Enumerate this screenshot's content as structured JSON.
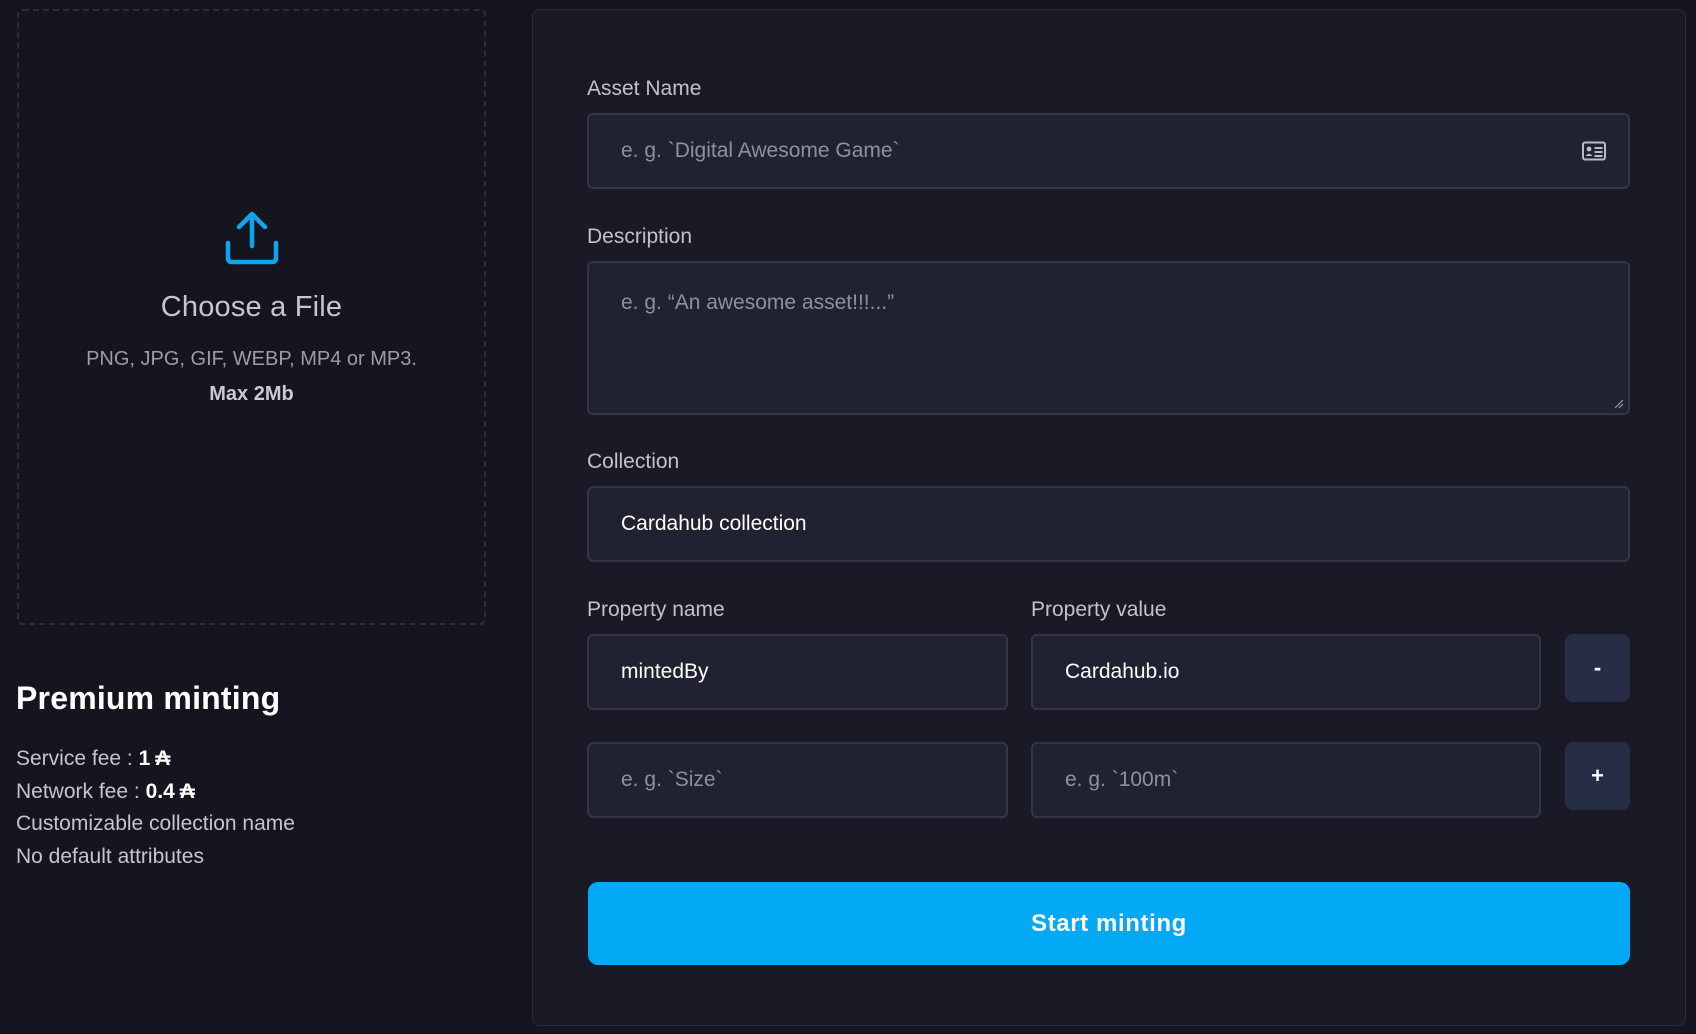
{
  "upload": {
    "title": "Choose a File",
    "types": "PNG, JPG, GIF, WEBP, MP4 or MP3.",
    "max": "Max 2Mb",
    "icon": "upload-icon",
    "accent": "#0ea5f0"
  },
  "premium": {
    "title": "Premium minting",
    "service_fee_label": "Service fee : ",
    "service_fee_value": "1",
    "network_fee_label": "Network fee : ",
    "network_fee_value": "0.4",
    "currency_symbol": "₳",
    "feature_1": "Customizable collection name",
    "feature_2": "No default attributes"
  },
  "form": {
    "asset_name": {
      "label": "Asset Name",
      "placeholder": "e. g. `Digital Awesome Game`",
      "value": "",
      "icon": "id-card-icon"
    },
    "description": {
      "label": "Description",
      "placeholder": "e. g. “An awesome asset!!!...”",
      "value": ""
    },
    "collection": {
      "label": "Collection",
      "value": "Cardahub collection"
    },
    "property_name_label": "Property name",
    "property_value_label": "Property value",
    "properties": [
      {
        "name": "mintedBy",
        "value": "Cardahub.io",
        "action": "-"
      },
      {
        "name_placeholder": "e. g. `Size`",
        "value_placeholder": "e. g. `100m`",
        "action": "+"
      }
    ],
    "submit_label": "Start minting",
    "submit_color": "#03a9f4"
  }
}
